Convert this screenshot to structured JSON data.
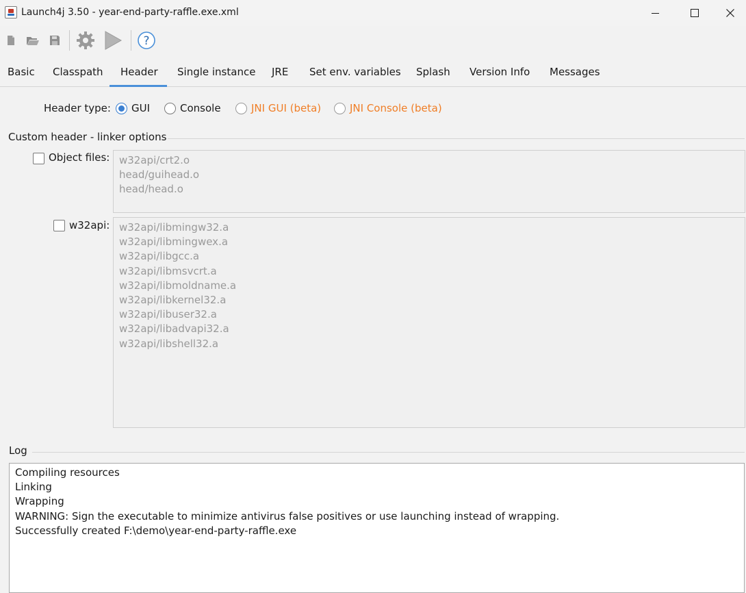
{
  "window": {
    "title": "Launch4j 3.50 - year-end-party-raffle.exe.xml"
  },
  "toolbar": {
    "buttons": [
      {
        "name": "new-icon"
      },
      {
        "name": "open-icon"
      },
      {
        "name": "save-icon"
      },
      {
        "name": "build-gear-icon"
      },
      {
        "name": "run-icon"
      },
      {
        "name": "help-icon",
        "glyph": "?"
      }
    ]
  },
  "tabs": [
    {
      "label": "Basic"
    },
    {
      "label": "Classpath"
    },
    {
      "label": "Header",
      "active": true
    },
    {
      "label": "Single instance"
    },
    {
      "label": "JRE"
    },
    {
      "label": "Set env. variables"
    },
    {
      "label": "Splash"
    },
    {
      "label": "Version Info"
    },
    {
      "label": "Messages"
    }
  ],
  "header": {
    "type_label": "Header type:",
    "options": [
      {
        "label": "GUI",
        "selected": true
      },
      {
        "label": "Console",
        "selected": false
      },
      {
        "label": "JNI GUI (beta)",
        "selected": false
      },
      {
        "label": "JNI Console (beta)",
        "selected": false
      }
    ],
    "accent_color": "#f07e26"
  },
  "custom_header": {
    "group_title": "Custom header - linker options",
    "object_files": {
      "label": "Object files:",
      "checked": false,
      "lines": [
        "w32api/crt2.o",
        "head/guihead.o",
        "head/head.o"
      ]
    },
    "w32api": {
      "label": "w32api:",
      "checked": false,
      "lines": [
        "w32api/libmingw32.a",
        "w32api/libmingwex.a",
        "w32api/libgcc.a",
        "w32api/libmsvcrt.a",
        "w32api/libmoldname.a",
        "w32api/libkernel32.a",
        "w32api/libuser32.a",
        "w32api/libadvapi32.a",
        "w32api/libshell32.a"
      ]
    }
  },
  "log": {
    "title": "Log",
    "lines": [
      "Compiling resources",
      "Linking",
      "Wrapping",
      "WARNING: Sign the executable to minimize antivirus false positives or use launching instead of wrapping.",
      "Successfully created F:\\demo\\year-end-party-raffle.exe"
    ]
  }
}
